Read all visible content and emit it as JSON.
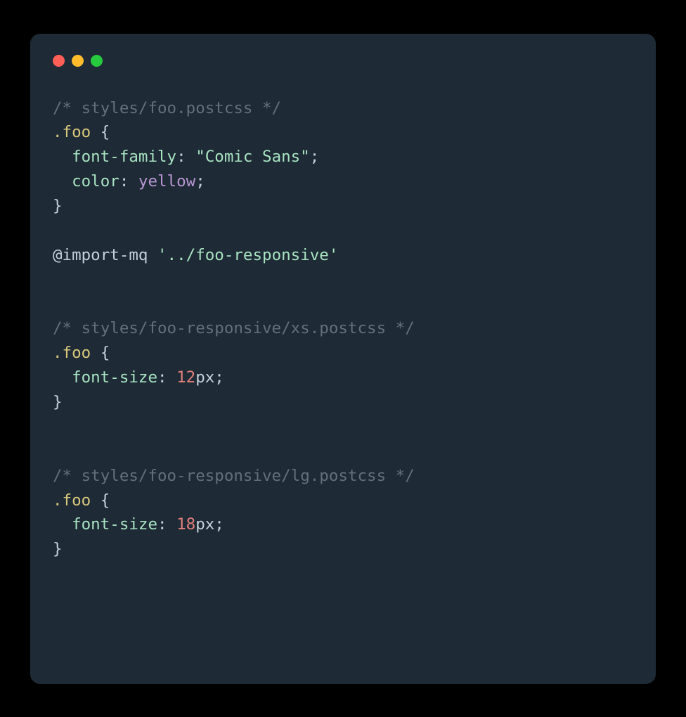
{
  "block1": {
    "comment": "/* styles/foo.postcss */",
    "selector": ".foo",
    "open_brace": " {",
    "indent": "  ",
    "prop1": "font-family",
    "colon": ": ",
    "val1": "\"Comic Sans\"",
    "semi": ";",
    "prop2": "color",
    "val2": "yellow",
    "close_brace": "}"
  },
  "import": {
    "at_rule": "@import-mq ",
    "path": "'../foo-responsive'"
  },
  "block2": {
    "comment": "/* styles/foo-responsive/xs.postcss */",
    "selector": ".foo",
    "open_brace": " {",
    "indent": "  ",
    "prop": "font-size",
    "colon": ": ",
    "num": "12",
    "unit": "px",
    "semi": ";",
    "close_brace": "}"
  },
  "block3": {
    "comment": "/* styles/foo-responsive/lg.postcss */",
    "selector": ".foo",
    "open_brace": " {",
    "indent": "  ",
    "prop": "font-size",
    "colon": ": ",
    "num": "18",
    "unit": "px",
    "semi": ";",
    "close_brace": "}"
  }
}
